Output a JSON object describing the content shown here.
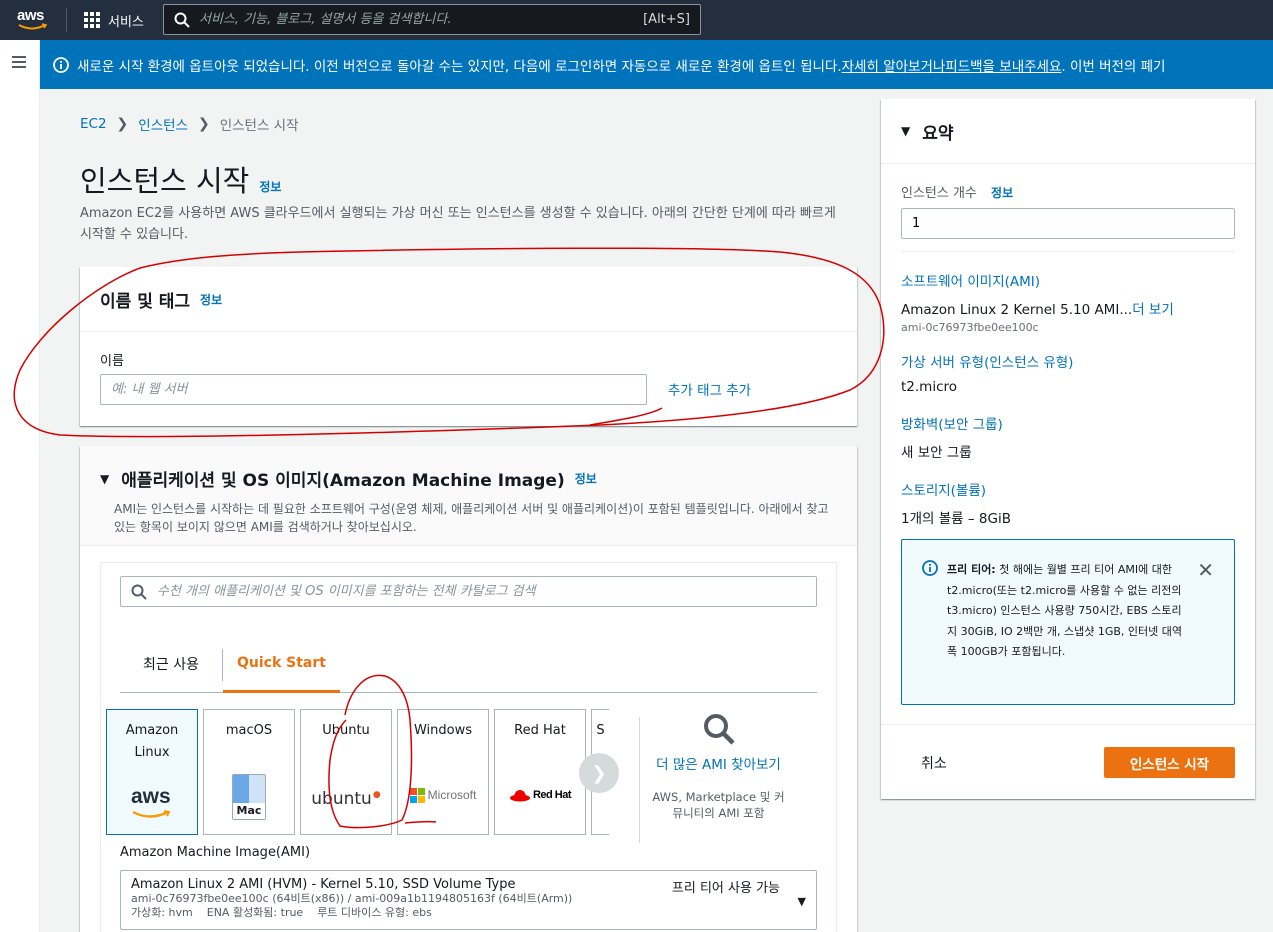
{
  "topnav": {
    "logo_text": "aws",
    "services_label": "서비스",
    "search_placeholder": "서비스, 기능, 블로그, 설명서 등을 검색합니다.",
    "search_shortcut": "[Alt+S]"
  },
  "banner": {
    "text": "새로운 시작 환경에 옵트아웃 되었습니다. 이전 버전으로 돌아갈 수는 있지만, 다음에 로그인하면 자동으로 새로운 환경에 옵트인 됩니다. ",
    "link1": "자세히 알아보거나",
    "gap": " ",
    "link2": "피드백을 보내주세요",
    "tail": ". 이번 버전의 폐기"
  },
  "breadcrumb": {
    "items": [
      "EC2",
      "인스턴스",
      "인스턴스 시작"
    ]
  },
  "page": {
    "title": "인스턴스 시작",
    "info": "정보",
    "description": "Amazon EC2를 사용하면 AWS 클라우드에서 실행되는 가상 머신 또는 인스턴스를 생성할 수 있습니다. 아래의 간단한 단계에 따라 빠르게 시작할 수 있습니다."
  },
  "name_panel": {
    "title": "이름 및 태그",
    "info": "정보",
    "label": "이름",
    "placeholder": "예: 내 웹 서버",
    "add_tag": "추가 태그 추가"
  },
  "ami_panel": {
    "title": "애플리케이션 및 OS 이미지(Amazon Machine Image)",
    "info": "정보",
    "subtitle": "AMI는 인스턴스를 시작하는 데 필요한 소프트웨어 구성(운영 체제, 애플리케이션 서버 및 애플리케이션)이 포함된 템플릿입니다. 아래에서 찾고 있는 항목이 보이지 않으면 AMI를 검색하거나 찾아보십시오.",
    "search_placeholder": "수천 개의 애플리케이션 및 OS 이미지를 포함하는 전체 카탈로그 검색",
    "tabs": [
      "최근 사용",
      "Quick Start"
    ],
    "os_options": [
      {
        "label": "Amazon Linux",
        "logo": "aws"
      },
      {
        "label": "macOS",
        "logo": "Mac"
      },
      {
        "label": "Ubuntu",
        "logo": "ubuntu"
      },
      {
        "label": "Windows",
        "logo": "Microsoft"
      },
      {
        "label": "Red Hat",
        "logo": "Red Hat"
      },
      {
        "label": "S",
        "logo": ""
      }
    ],
    "more_title": "더 많은 AMI 찾아보기",
    "more_sub": "AWS, Marketplace 및 커뮤니티의 AMI 포함",
    "ami_label": "Amazon Machine Image(AMI)",
    "selected": {
      "name": "Amazon Linux 2 AMI (HVM) - Kernel 5.10, SSD Volume Type",
      "ids": "ami-0c76973fbe0ee100c (64비트(x86)) / ami-009a1b1194805163f (64비트(Arm))",
      "meta": "가상화: hvm    ENA 활성화됨: true    루트 디바이스 유형: ebs",
      "badge": "프리 티어 사용 가능"
    }
  },
  "summary": {
    "title": "요약",
    "count_label": "인스턴스 개수",
    "count_info": "정보",
    "count_value": "1",
    "ami_link": "소프트웨어 이미지(AMI)",
    "ami_value": "Amazon Linux 2 Kernel 5.10 AMI...",
    "ami_more": "더 보기",
    "ami_id": "ami-0c76973fbe0ee100c",
    "type_link": "가상 서버 유형(인스턴스 유형)",
    "type_value": "t2.micro",
    "fw_link": "방화벽(보안 그룹)",
    "fw_value": "새 보안 그룹",
    "storage_link": "스토리지(볼륨)",
    "storage_value": "1개의 볼륨 – 8GiB",
    "freetier_bold": "프리 티어:",
    "freetier_text": " 첫 해에는 월별 프리 티어 AMI에 대한 t2.micro(또는 t2.micro를 사용할 수 없는 리전의 t3.micro) 인스턴스 사용량 750시간, EBS 스토리지 30GiB, IO 2백만 개, 스냅샷 1GB, 인터넷 대역폭 100GB가 포함됩니다.",
    "cancel": "취소",
    "launch": "인스턴스 시작"
  },
  "colors": {
    "nav": "#232f3e",
    "banner": "#0073bb",
    "accent": "#ec7211",
    "link": "#0073bb",
    "annotation": "#d40000"
  }
}
